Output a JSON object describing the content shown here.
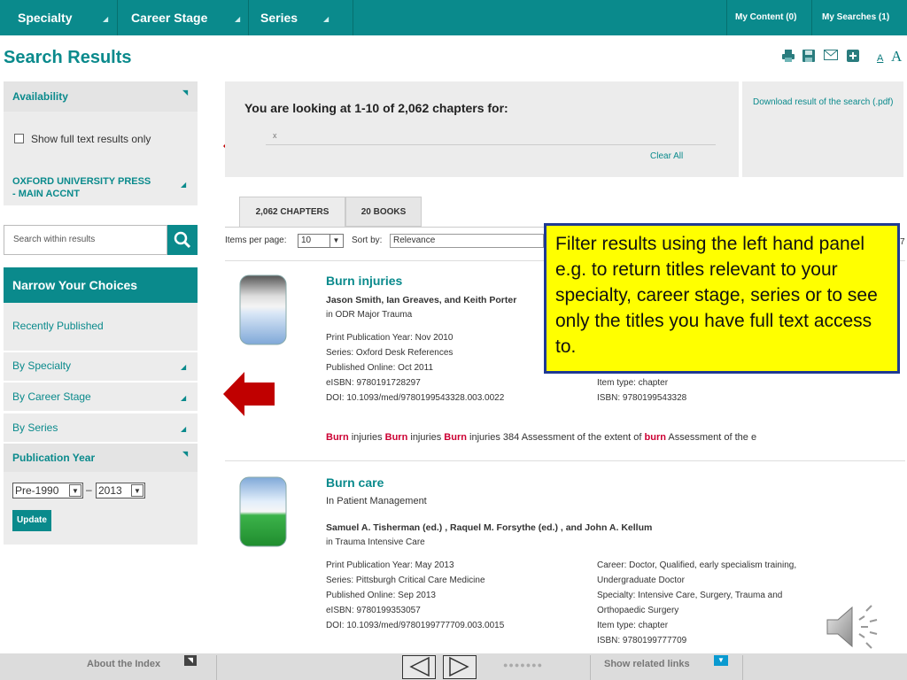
{
  "nav": {
    "items": [
      "Specialty",
      "Career Stage",
      "Series"
    ],
    "my_content": "My Content (0)",
    "my_searches": "My Searches (1)"
  },
  "page_title": "Search Results",
  "toolbar": {
    "font_small": "A",
    "font_large": "A"
  },
  "sidebar": {
    "availability": "Availability",
    "full_text_checkbox": "Show full text results only",
    "account": "OXFORD UNIVERSITY PRESS - MAIN ACCNT",
    "search_placeholder": "Search within results",
    "narrow": "Narrow Your Choices",
    "recently_published": "Recently Published",
    "by_specialty": "By Specialty",
    "by_career": "By Career Stage",
    "by_series": "By Series",
    "pub_year": "Publication Year",
    "year_from": "Pre-1990",
    "year_dash": "–",
    "year_to": "2013",
    "update": "Update"
  },
  "results_header": {
    "looking_at": "You are looking at 1-10 of 2,062 chapters for:",
    "x_mark": "x",
    "clear_all": "Clear All",
    "download": "Download result of the search (.pdf)"
  },
  "tabs": [
    "2,062 CHAPTERS",
    "20 BOOKS"
  ],
  "controls": {
    "items_per_page_label": "Items per page:",
    "items_per_page": "10",
    "sort_by_label": "Sort by:",
    "sort_by": "Relevance",
    "page_num_partial": "7"
  },
  "results": [
    {
      "title": "Burn injuries",
      "authors": "Jason Smith, Ian Greaves, and Keith Porter",
      "in_book": "in ODR Major Trauma",
      "left_meta": [
        "Print Publication Year: Nov 2010",
        "Series: Oxford Desk References",
        "Published Online: Oct 2011",
        "eISBN: 9780191728297",
        "DOI: 10.1093/med/9780199543328.003.0022"
      ],
      "right_meta": [
        "Item type: chapter",
        "ISBN: 9780199543328"
      ],
      "snippet": [
        {
          "t": "Burn",
          "hl": true
        },
        {
          "t": " injuries ",
          "hl": false
        },
        {
          "t": "Burn",
          "hl": true
        },
        {
          "t": " injuries ",
          "hl": false
        },
        {
          "t": "Burn",
          "hl": true
        },
        {
          "t": " injuries 384 Assessment of the extent of ",
          "hl": false
        },
        {
          "t": "burn",
          "hl": true
        },
        {
          "t": " Assessment of the e",
          "hl": false
        }
      ]
    },
    {
      "title": "Burn care",
      "subtitle": "In Patient Management",
      "authors": "Samuel A. Tisherman  (ed.) , Raquel M. Forsythe  (ed.) , and John A. Kellum",
      "in_book": "in Trauma Intensive Care",
      "left_meta": [
        "Print Publication Year: May 2013",
        "Series: Pittsburgh Critical Care Medicine",
        "Published Online: Sep 2013",
        "eISBN: 9780199353057",
        "DOI: 10.1093/med/9780199777709.003.0015"
      ],
      "right_meta": [
        "Career: Doctor, Qualified, early specialism training,",
        "Undergraduate Doctor",
        "Specialty: Intensive Care, Surgery, Trauma and",
        "Orthopaedic Surgery",
        "Item type: chapter",
        "ISBN: 9780199777709"
      ]
    }
  ],
  "callout": "Filter results using the left hand panel e.g. to return titles relevant to your specialty, career stage, series or to see only the titles you have full text access to.",
  "bottom": {
    "about": "About the Index",
    "related": "Show related links",
    "dots": "●●●●●●●"
  },
  "colors": {
    "teal": "#0a8a8c",
    "highlight": "#cc0033",
    "callout_bg": "#ffff00",
    "arrow": "#c00000"
  }
}
